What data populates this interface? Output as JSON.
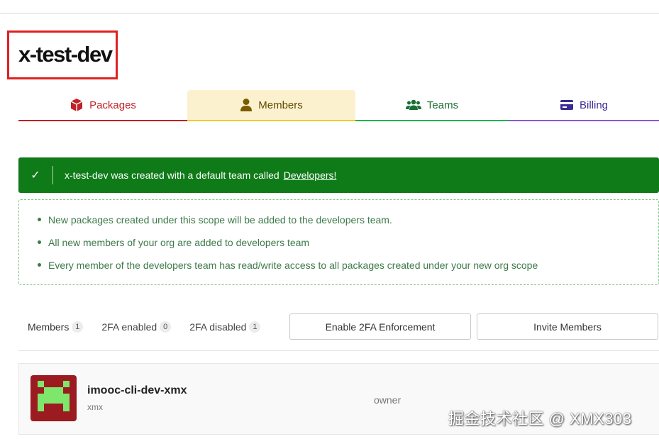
{
  "org": {
    "title": "x-test-dev"
  },
  "tabs": [
    {
      "label": "Packages",
      "icon": "package-icon",
      "color": "#c12127"
    },
    {
      "label": "Members",
      "icon": "user-icon",
      "color": "#5e4a00"
    },
    {
      "label": "Teams",
      "icon": "users-icon",
      "color": "#1a6f34"
    },
    {
      "label": "Billing",
      "icon": "credit-card-icon",
      "color": "#3b2b94"
    }
  ],
  "banner": {
    "text": "x-test-dev was created with a default team called",
    "link": "Developers!",
    "color": "#0f7a18"
  },
  "notes": [
    "New packages created under this scope will be added to the developers team.",
    "All new members of your org are added to developers team",
    "Every member of the developers team has read/write access to all packages created under your new org scope"
  ],
  "stats": [
    {
      "label": "Members",
      "count": "1"
    },
    {
      "label": "2FA enabled",
      "count": "0"
    },
    {
      "label": "2FA disabled",
      "count": "1"
    }
  ],
  "buttons": {
    "enable_2fa": "Enable 2FA Enforcement",
    "invite": "Invite Members"
  },
  "members": [
    {
      "name": "imooc-cli-dev-xmx",
      "sub": "xmx",
      "role": "owner"
    }
  ],
  "watermark": "掘金技术社区 @ XMX303"
}
